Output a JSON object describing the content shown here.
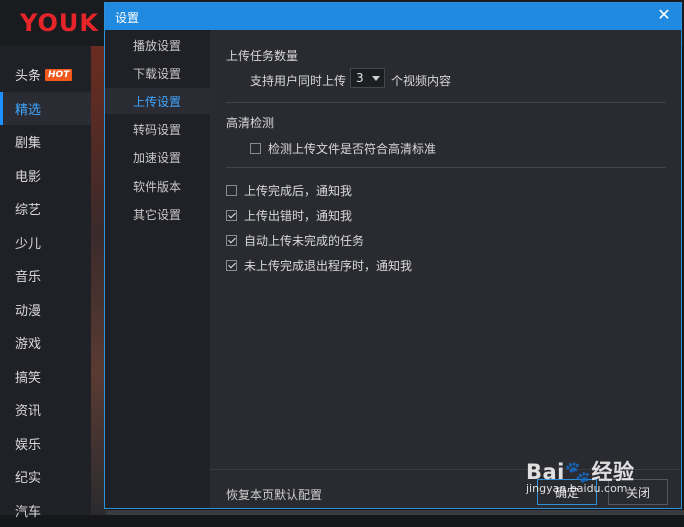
{
  "app": {
    "logo": "YOUK",
    "sidebar": [
      {
        "label": "头条",
        "badge": "HOT"
      },
      {
        "label": "精选"
      },
      {
        "label": "剧集"
      },
      {
        "label": "电影"
      },
      {
        "label": "综艺"
      },
      {
        "label": "少儿"
      },
      {
        "label": "音乐"
      },
      {
        "label": "动漫"
      },
      {
        "label": "游戏"
      },
      {
        "label": "搞笑"
      },
      {
        "label": "资讯"
      },
      {
        "label": "娱乐"
      },
      {
        "label": "纪实"
      },
      {
        "label": "汽车"
      }
    ],
    "active_sidebar": "精选"
  },
  "dialog": {
    "title": "设置",
    "nav": [
      "播放设置",
      "下载设置",
      "上传设置",
      "转码设置",
      "加速设置",
      "软件版本",
      "其它设置"
    ],
    "active_nav": "上传设置",
    "upload_count": {
      "section_title": "上传任务数量",
      "prefix": "支持用户同时上传",
      "value": "3",
      "suffix": "个视频内容"
    },
    "hd_check": {
      "section_title": "高清检测",
      "checkbox_label": "检测上传文件是否符合高清标准",
      "checked": false
    },
    "notifications": [
      {
        "label": "上传完成后，通知我",
        "checked": false
      },
      {
        "label": "上传出错时，通知我",
        "checked": true
      },
      {
        "label": "自动上传未完成的任务",
        "checked": true
      },
      {
        "label": "未上传完成退出程序时，通知我",
        "checked": true
      }
    ],
    "footer": {
      "restore_label": "恢复本页默认配置",
      "ok_label": "确定",
      "close_label": "关闭"
    }
  },
  "watermark": {
    "logo": "Bai🐾经验",
    "url": "jingyan.baidu.com"
  },
  "colors": {
    "accent": "#1f8ae0",
    "active_text": "#3fa6ff",
    "brand_red": "#e6252a",
    "hot_badge": "#f25a1d"
  }
}
